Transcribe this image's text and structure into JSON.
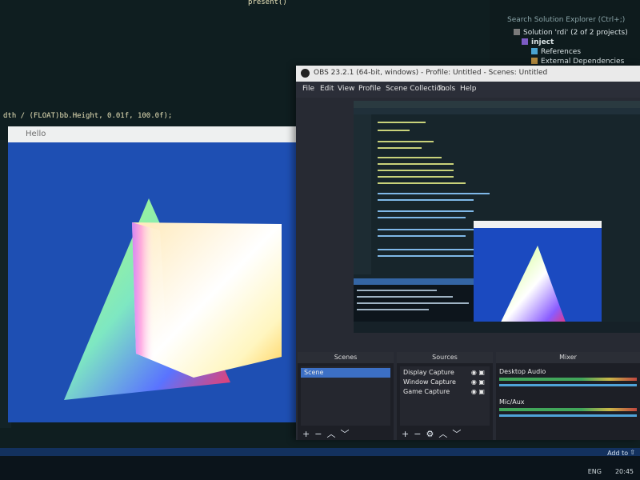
{
  "ide": {
    "code_top_right": "present()",
    "code_dim_line": "dth / (FLOAT)bb.Height, 0.01f, 100.0f);",
    "solution_search": "Search Solution Explorer (Ctrl+;)",
    "solution_label": "Solution 'rdi' (2 of 2 projects)",
    "project": "inject",
    "references": "References",
    "external_deps": "External Dependencies"
  },
  "render_window": {
    "title": "Hello"
  },
  "obs": {
    "title": "OBS 23.2.1 (64-bit, windows) - Profile: Untitled - Scenes: Untitled",
    "menu": [
      "File",
      "Edit",
      "View",
      "Profile",
      "Scene Collection",
      "Tools",
      "Help"
    ],
    "scenes": {
      "title": "Scenes",
      "items": [
        "Scene"
      ]
    },
    "sources": {
      "title": "Sources",
      "items": [
        "Display Capture",
        "Window Capture",
        "Game Capture"
      ]
    },
    "mixer": {
      "title": "Mixer",
      "channels": [
        "Desktop Audio",
        "Mic/Aux"
      ]
    }
  },
  "statusbar": {
    "add_to_source_control": "Add to Source Control"
  },
  "taskbar": {
    "lang": "ENG",
    "time": "20:45"
  },
  "colors": {
    "render_bg": "#1e4fb3",
    "selection": "#3c6fc4",
    "obs_bg": "#272a33"
  }
}
